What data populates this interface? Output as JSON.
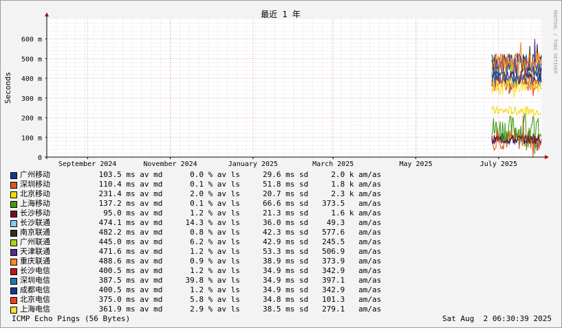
{
  "chart_data": {
    "type": "line",
    "title": "最近 1 年",
    "ylabel": "Seconds",
    "xlabel": "",
    "side_label": "RRDTOOL / TOBI OETIKER",
    "ylim": [
      0,
      0.7
    ],
    "y_ticks": [
      {
        "value": 0,
        "label": "0"
      },
      {
        "value": 0.1,
        "label": "100 m"
      },
      {
        "value": 0.2,
        "label": "200 m"
      },
      {
        "value": 0.3,
        "label": "300 m"
      },
      {
        "value": 0.4,
        "label": "400 m"
      },
      {
        "value": 0.5,
        "label": "500 m"
      },
      {
        "value": 0.6,
        "label": "600 m"
      }
    ],
    "x_range": [
      "2024-08-02",
      "2025-08-02"
    ],
    "x_ticks": [
      {
        "date": "2024-09-01",
        "label": "September 2024"
      },
      {
        "date": "2024-11-01",
        "label": "November 2024"
      },
      {
        "date": "2025-01-01",
        "label": "January 2025"
      },
      {
        "date": "2025-03-01",
        "label": "March 2025"
      },
      {
        "date": "2025-05-01",
        "label": "May 2025"
      },
      {
        "date": "2025-07-01",
        "label": "July 2025"
      }
    ],
    "data_start": "2025-06-26",
    "series": [
      {
        "name": "广州移动",
        "color": "#0a3e8e",
        "median": "103.5 ms av md",
        "loss": "0.0 % av ls",
        "sd": "29.6 ms sd",
        "amas": "2.0 k am/as",
        "level": 0.0935
      },
      {
        "name": "深圳移动",
        "color": "#e2561d",
        "median": "110.4 ms av md",
        "loss": "0.1 % av ls",
        "sd": "51.8 ms sd",
        "amas": "1.8 k am/as",
        "level": 0.092
      },
      {
        "name": "北京移动",
        "color": "#f7d900",
        "median": "231.4 ms av md",
        "loss": "2.0 % av ls",
        "sd": "20.7 ms sd",
        "amas": "2.3 k am/as",
        "level": 0.235
      },
      {
        "name": "上海移动",
        "color": "#3f9d12",
        "median": "137.2 ms av md",
        "loss": "0.1 % av ls",
        "sd": "66.6 ms sd",
        "amas": "373.5   am/as",
        "level": 0.14
      },
      {
        "name": "长沙移动",
        "color": "#7a0a22",
        "median": "95.0 ms av md",
        "loss": "1.2 % av ls",
        "sd": "21.3 ms sd",
        "amas": "1.6 k am/as",
        "level": 0.09
      },
      {
        "name": "长沙联通",
        "color": "#7fc9ff",
        "median": "474.1 ms av md",
        "loss": "14.3 % av ls",
        "sd": "36.0 ms sd",
        "amas": "49.3   am/as",
        "level": 0.474
      },
      {
        "name": "南京联通",
        "color": "#2f3317",
        "median": "482.2 ms av md",
        "loss": "0.8 % av ls",
        "sd": "42.3 ms sd",
        "amas": "577.6   am/as",
        "level": 0.482
      },
      {
        "name": "广州联通",
        "color": "#a7d417",
        "median": "445.0 ms av md",
        "loss": "6.2 % av ls",
        "sd": "42.9 ms sd",
        "amas": "245.5   am/as",
        "level": 0.445
      },
      {
        "name": "天津联通",
        "color": "#5a2b8e",
        "median": "471.6 ms av md",
        "loss": "1.2 % av ls",
        "sd": "53.3 ms sd",
        "amas": "506.9   am/as",
        "level": 0.4716
      },
      {
        "name": "重庆联通",
        "color": "#ff8a1f",
        "median": "488.6 ms av md",
        "loss": "0.9 % av ls",
        "sd": "38.9 ms sd",
        "amas": "373.9   am/as",
        "level": 0.4886
      },
      {
        "name": "长沙电信",
        "color": "#c1121f",
        "median": "400.5 ms av md",
        "loss": "1.2 % av ls",
        "sd": "34.9 ms sd",
        "amas": "342.9   am/as",
        "level": 0.4005
      },
      {
        "name": "深圳电信",
        "color": "#1f78b4",
        "median": "387.5 ms av md",
        "loss": "39.8 % av ls",
        "sd": "34.9 ms sd",
        "amas": "397.1   am/as",
        "level": 0.3875
      },
      {
        "name": "成都电信",
        "color": "#173a86",
        "median": "400.5 ms av md",
        "loss": "1.2 % av ls",
        "sd": "34.9 ms sd",
        "amas": "342.9   am/as",
        "level": 0.4005
      },
      {
        "name": "北京电信",
        "color": "#f0421a",
        "median": "375.0 ms av md",
        "loss": "5.8 % av ls",
        "sd": "34.8 ms sd",
        "amas": "101.3   am/as",
        "level": 0.375
      },
      {
        "name": "上海电信",
        "color": "#ffe12e",
        "median": "361.9 ms av md",
        "loss": "2.9 % av ls",
        "sd": "38.5 ms sd",
        "amas": "279.1   am/as",
        "level": 0.3619
      }
    ]
  },
  "footer": {
    "left": "ICMP Echo Pings (56 Bytes)",
    "right": "Sat Aug  2 06:30:39 2025"
  }
}
